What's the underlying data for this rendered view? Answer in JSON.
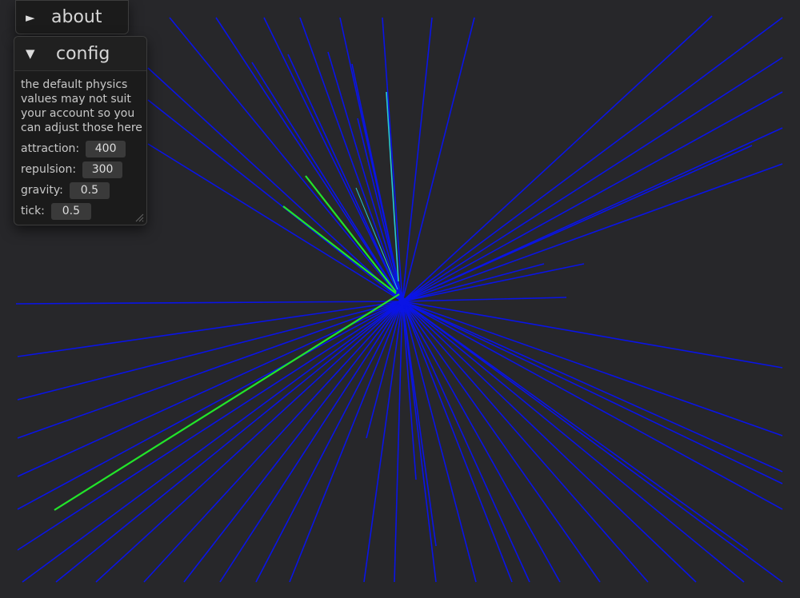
{
  "about": {
    "title": "about",
    "arrow": "►"
  },
  "config": {
    "title": "config",
    "arrow": "▼",
    "description": "the default physics values may not suit your account so you can adjust those here",
    "fields": [
      {
        "label": "attraction:",
        "value": "400"
      },
      {
        "label": "repulsion:",
        "value": "300"
      },
      {
        "label": "gravity:",
        "value": "0.5"
      },
      {
        "label": "tick:",
        "value": "0.5"
      }
    ]
  },
  "colors": {
    "background": "#27272a",
    "edge_default": "#0a14e6",
    "edge_highlight": "#22e62a",
    "edge_cyan": "#28c8d2"
  }
}
